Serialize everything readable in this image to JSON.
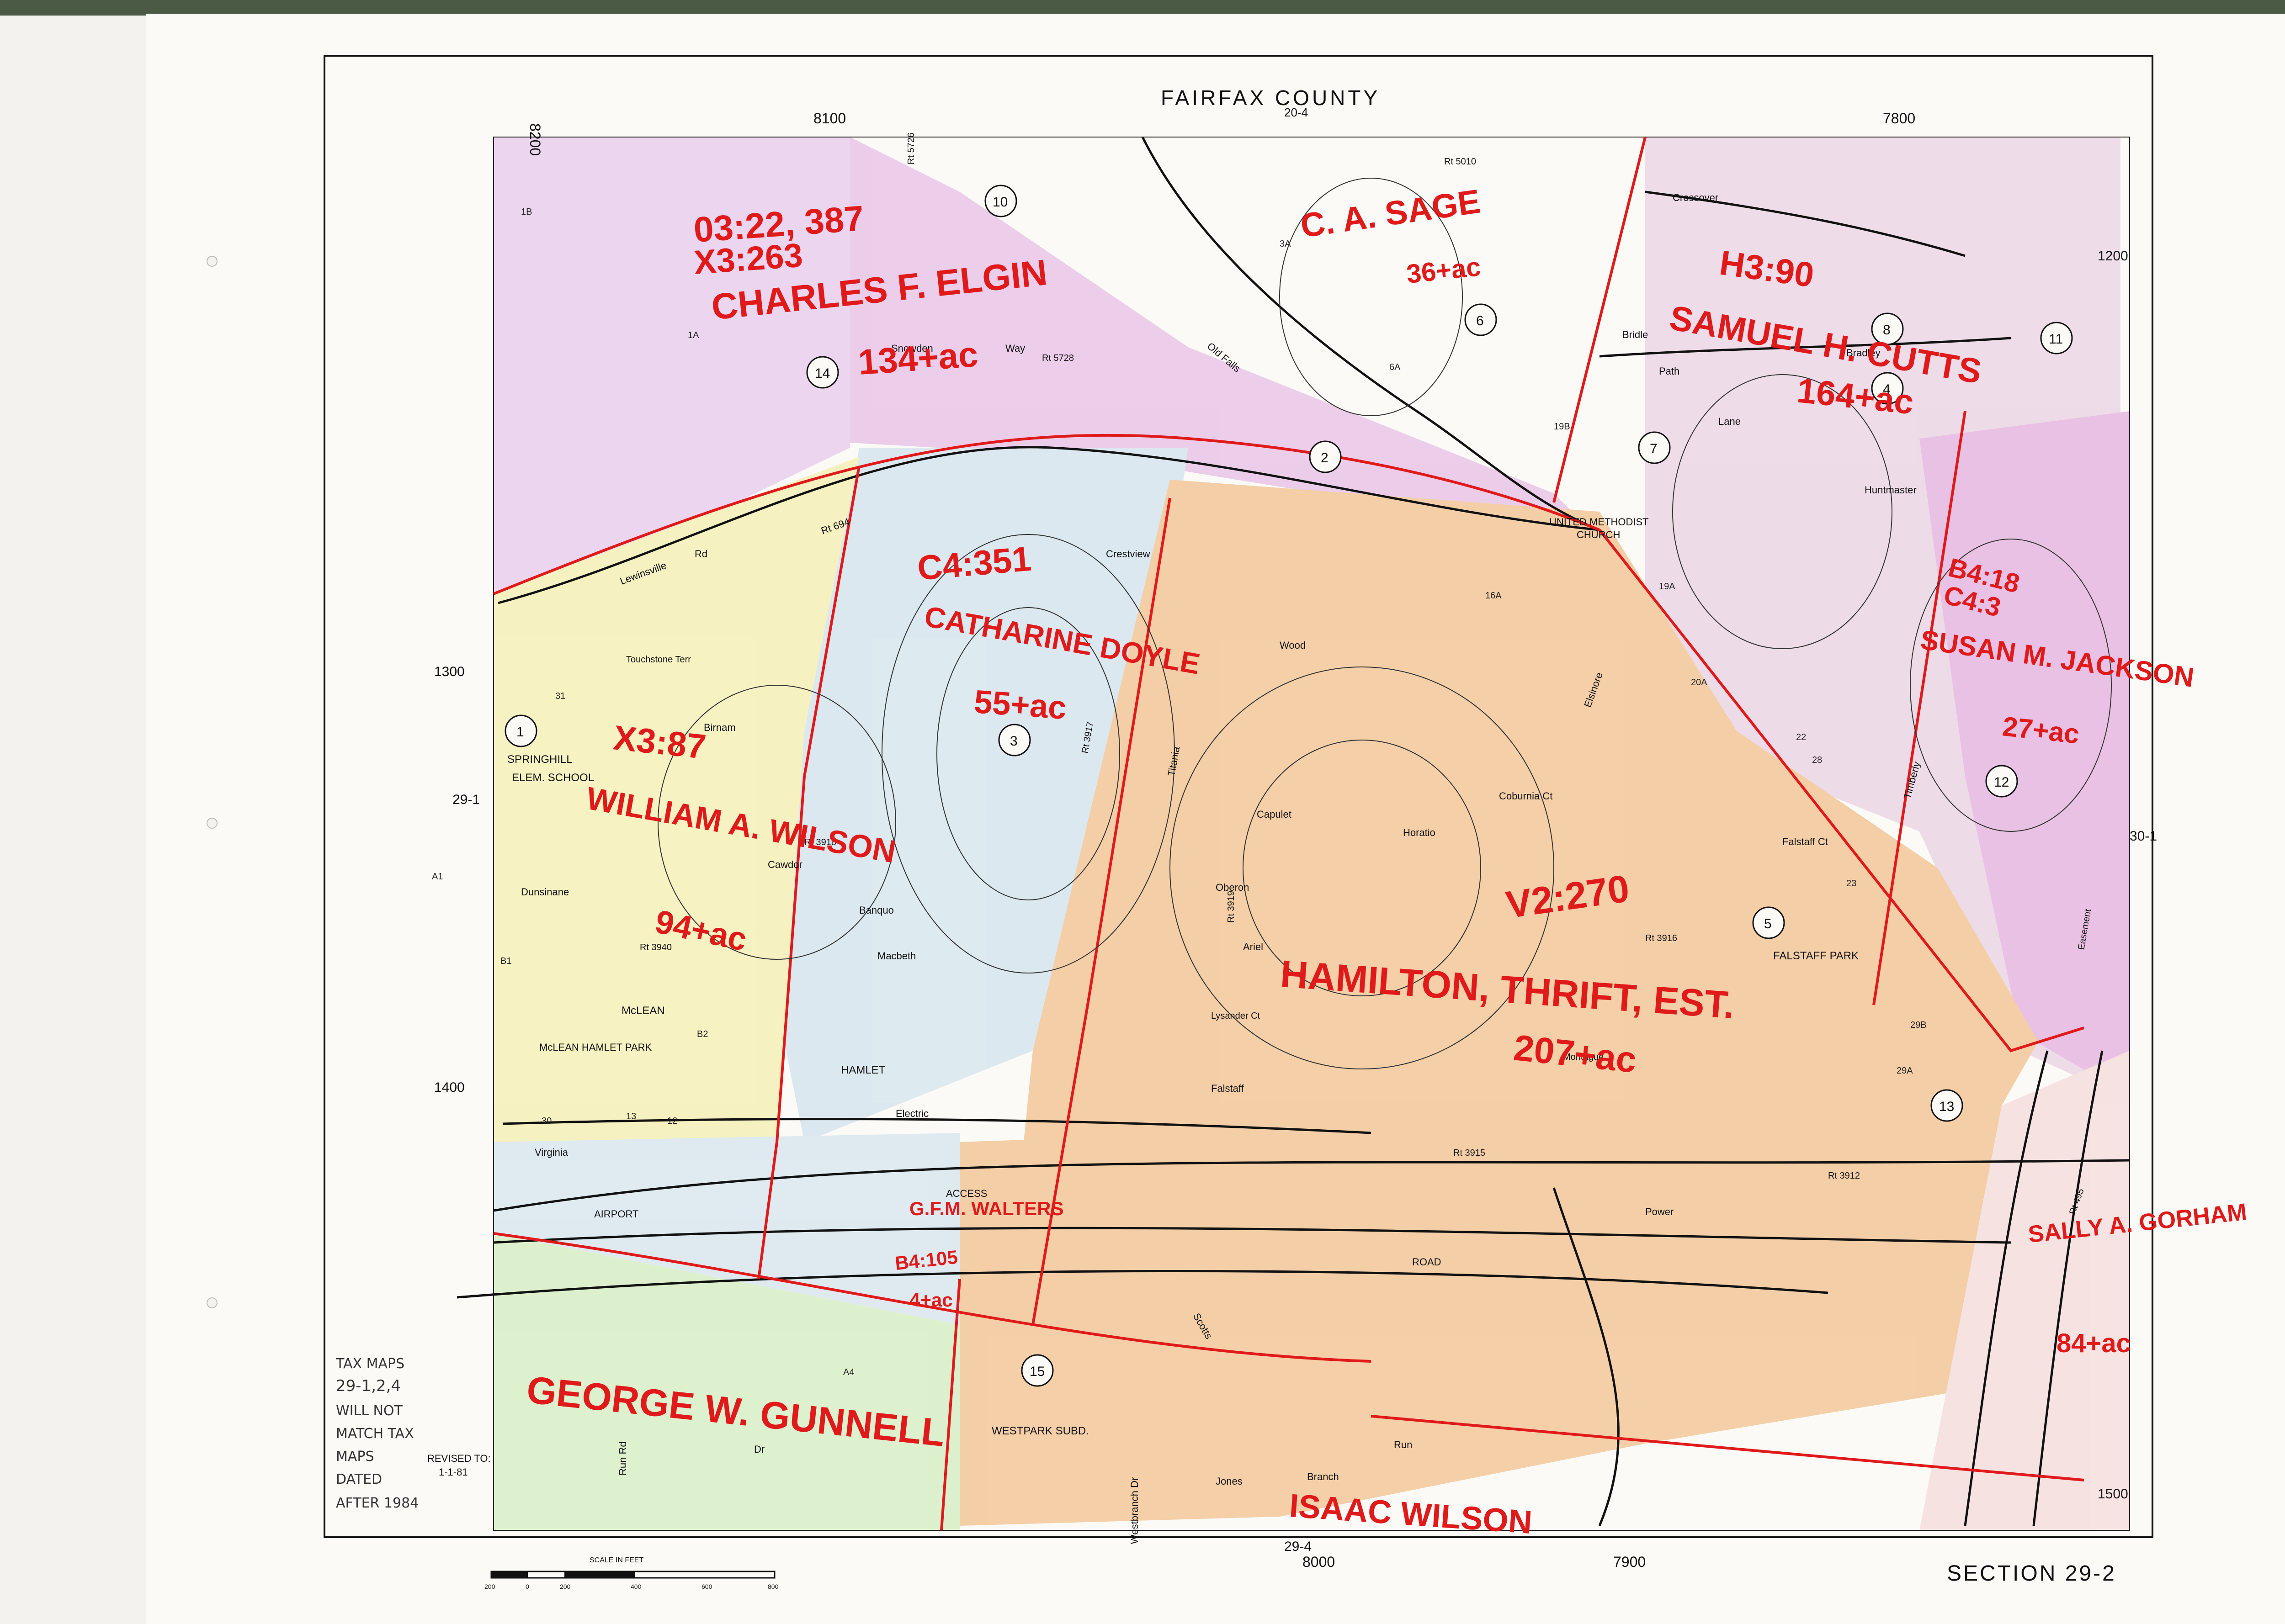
{
  "map": {
    "county": "FAIRFAX COUNTY",
    "map_top_ref": "20-4",
    "map_bottom_ref": "29-4",
    "map_left_ref": "29-1",
    "map_right_ref": "30-1",
    "section": "SECTION 29-2",
    "scale_label": "SCALE IN FEET",
    "scale_ticks": [
      "200",
      "0",
      "200",
      "400",
      "600",
      "800"
    ],
    "revised_label": "REVISED TO:",
    "revised_date": "1-1-81",
    "grid_labels": [
      "8200",
      "8100",
      "8000",
      "7900",
      "7800",
      "1200",
      "1300",
      "1400",
      "1500"
    ]
  },
  "places": {
    "elem_school": "SPRINGHILL",
    "elem_school2": "ELEM. SCHOOL",
    "church": "UNITED METHODIST",
    "church2": "CHURCH",
    "falstaff_park": "FALSTAFF PARK",
    "mclean": "McLEAN",
    "mclean_hamlet_park": "McLEAN HAMLET PARK",
    "hamlet": "HAMLET",
    "westpark": "WESTPARK SUBD.",
    "access": "ACCESS",
    "airport": "AIRPORT",
    "road": "ROAD",
    "electric": "Electric",
    "power": "Power",
    "virginia": "Virginia",
    "lewinsville": "Lewinsville",
    "rd": "Rd",
    "jones": "Jones",
    "branch": "Branch",
    "run": "Run",
    "dr": "Dr",
    "scotts": "Scotts",
    "crossover": "Crossover",
    "bradley": "Bradley",
    "snowden": "Snowden",
    "way": "Way",
    "old_falls": "Old Falls",
    "capulet": "Capulet",
    "oberon": "Oberon",
    "ariel": "Ariel",
    "lysander_ct": "Lysander Ct",
    "falstaff": "Falstaff",
    "birnam": "Birnam",
    "macbeth": "Macbeth",
    "dunsinane": "Dunsinane",
    "touchstone_terr": "Touchstone Terr",
    "cawdor": "Cawdor",
    "banquo": "Banquo",
    "horatio": "Horatio",
    "titania": "Titania",
    "montague": "Montague",
    "falstaff_ct": "Falstaff Ct",
    "bridle": "Bridle",
    "path": "Path",
    "lane": "Lane",
    "huntmaster": "Huntmaster",
    "crestview": "Crestview",
    "wood": "Wood",
    "coburnia_ct": "Coburnia Ct",
    "elsinore": "Elsinore",
    "timberly": "Timberly",
    "easement": "Easement",
    "run_rd": "Run Rd",
    "westbranch_dr": "Westbranch Dr"
  },
  "routes": [
    "Rt 694",
    "Rt 3915",
    "Rt 3917",
    "Rt 3918",
    "Rt 3919",
    "Rt 3912",
    "Rt 5728",
    "Rt 5726",
    "Rt 5010",
    "Rt 495",
    "Rt 3940",
    "Rt 3916"
  ],
  "parcel_numbers": [
    "1",
    "2",
    "3",
    "4",
    "5",
    "6",
    "7",
    "8",
    "10",
    "11",
    "12",
    "13",
    "14",
    "15"
  ],
  "lot_samples": [
    "1B",
    "1A",
    "31",
    "30",
    "13",
    "12",
    "B1",
    "B2",
    "A4",
    "A1",
    "20A",
    "22",
    "19A",
    "19B",
    "16A",
    "6A",
    "3A",
    "29B",
    "29A",
    "23",
    "28",
    "8",
    "15",
    "10",
    "11",
    "12",
    "13"
  ],
  "handwritten": {
    "elgin_refs": "03:22, 387",
    "elgin_refs2": "X3:263",
    "elgin_name": "CHARLES F. ELGIN",
    "elgin_area": "134+ac",
    "sage_name": "C. A. SAGE",
    "sage_area": "36+ac",
    "cutts_ref": "H3:90",
    "cutts_name": "SAMUEL H. CUTTS",
    "cutts_area": "164+ac",
    "doyle_ref": "C4:351",
    "doyle_name": "CATHARINE DOYLE",
    "doyle_area": "55+ac",
    "wilson_ref": "X3:87",
    "wilson_name": "WILLIAM A. WILSON",
    "wilson_area": "94+ac",
    "jackson_ref": "B4:18",
    "jackson_ref2": "C4:3",
    "jackson_name": "SUSAN M. JACKSON",
    "jackson_area": "27+ac",
    "hamilton_ref": "V2:270",
    "hamilton_name": "HAMILTON, THRIFT, EST.",
    "hamilton_area": "207+ac",
    "walters_name": "G.F.M. WALTERS",
    "walters_ref": "B4:105",
    "walters_area": "4+ac",
    "gorham_name": "SALLY A. GORHAM",
    "gorham_area": "84+ac",
    "gunnell_name": "GEORGE W. GUNNELL",
    "isaac_name": "ISAAC WILSON",
    "note1": "TAX MAPS",
    "note2": "29-1,2,4",
    "note3": "WILL NOT",
    "note4": "MATCH TAX",
    "note5": "MAPS",
    "note6": "DATED",
    "note7": "AFTER 1984"
  },
  "colors": {
    "ink_red": "#e01a1a",
    "pink_region": "#e9c6e8",
    "orange_region": "#f2c79a",
    "blue_region": "#d7e6ee",
    "yellow_region": "#f6f0b8",
    "green_region": "#d8efc8"
  }
}
